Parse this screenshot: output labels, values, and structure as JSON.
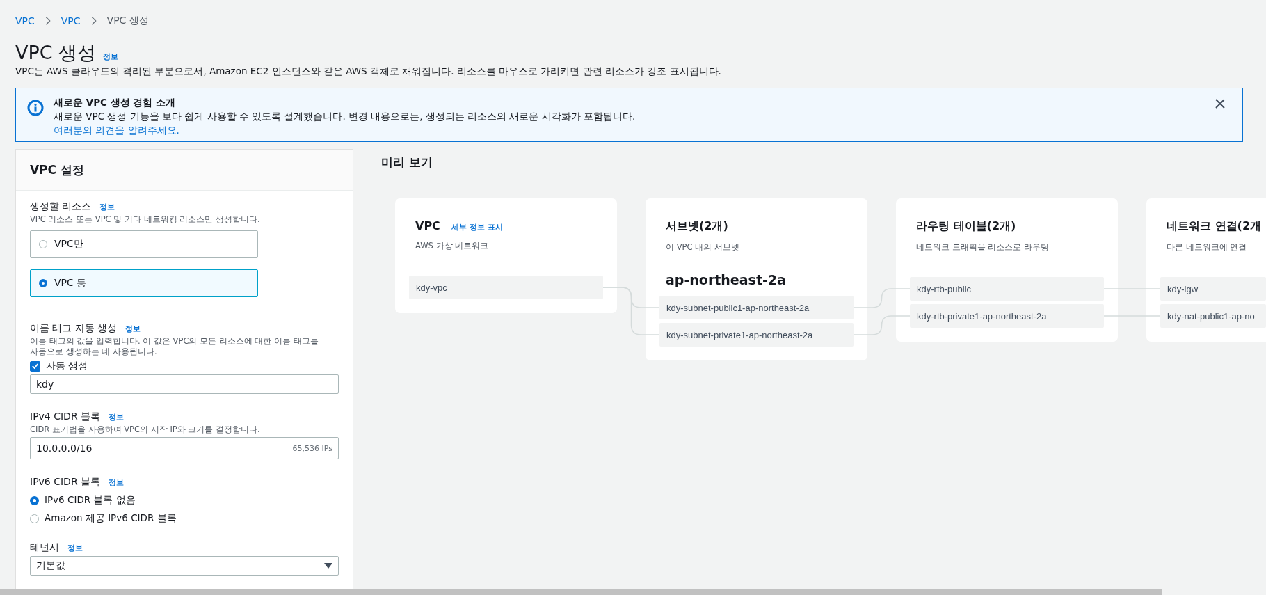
{
  "breadcrumbs": [
    {
      "label": "VPC",
      "link": true
    },
    {
      "label": "VPC",
      "link": true
    },
    {
      "label": "VPC 생성",
      "link": false
    }
  ],
  "page": {
    "title": "VPC 생성",
    "info": "정보",
    "description": "VPC는 AWS 클라우드의 격리된 부분으로서, Amazon EC2 인스턴스와 같은 AWS 객체로 채워집니다. 리소스를 마우스로 가리키면 관련 리소스가 강조 표시됩니다."
  },
  "alert": {
    "title": "새로운 VPC 생성 경험 소개",
    "message": "새로운 VPC 생성 기능을 보다 쉽게 사용할 수 있도록 설계했습니다. 변경 내용으로는, 생성되는 리소스의 새로운 시각화가 포함됩니다.",
    "link": "여러분의 의견을 알려주세요."
  },
  "settings": {
    "title": "VPC 설정",
    "resources": {
      "label": "생성할 리소스",
      "info": "정보",
      "description": "VPC 리소스 또는 VPC 및 기타 네트워킹 리소스만 생성합니다.",
      "options": [
        {
          "label": "VPC만",
          "selected": false
        },
        {
          "label": "VPC 등",
          "selected": true
        }
      ]
    },
    "name_tag": {
      "label": "이름 태그 자동 생성",
      "info": "정보",
      "description": "이름 태그의 값을 입력합니다. 이 값은 VPC의 모든 리소스에 대한 이름 태그를 자동으로 생성하는 데 사용됩니다.",
      "auto": {
        "label": "자동 생성",
        "checked": true
      },
      "value": "kdy"
    },
    "ipv4": {
      "label": "IPv4 CIDR 블록",
      "info": "정보",
      "description": "CIDR 표기법을 사용하여 VPC의 시작 IP와 크기를 결정합니다.",
      "value": "10.0.0.0/16",
      "hint": "65,536 IPs"
    },
    "ipv6": {
      "label": "IPv6 CIDR 블록",
      "info": "정보",
      "options": [
        {
          "label": "IPv6 CIDR 블록 없음",
          "selected": true
        },
        {
          "label": "Amazon 제공 IPv6 CIDR 블록",
          "selected": false
        }
      ]
    },
    "tenancy": {
      "label": "테넌시",
      "info": "정보",
      "value": "기본값"
    }
  },
  "preview": {
    "title": "미리 보기",
    "cards": [
      {
        "title": "VPC",
        "link": "세부 정보 표시",
        "subtitle": "AWS 가상 네트워크",
        "items": [
          "kdy-vpc"
        ]
      },
      {
        "title": "서브넷(2개)",
        "subtitle": "이 VPC 내의 서브넷",
        "group": "ap-northeast-2a",
        "items": [
          "kdy-subnet-public1-ap-northeast-2a",
          "kdy-subnet-private1-ap-northeast-2a"
        ]
      },
      {
        "title": "라우팅 테이블(2개)",
        "subtitle": "네트워크 트래픽을 리소스로 라우팅",
        "items": [
          "kdy-rtb-public",
          "kdy-rtb-private1-ap-northeast-2a"
        ]
      },
      {
        "title": "네트워크 연결(2개",
        "subtitle": "다른 네트워크에 연결",
        "items": [
          "kdy-igw",
          "kdy-nat-public1-ap-no"
        ]
      }
    ]
  }
}
